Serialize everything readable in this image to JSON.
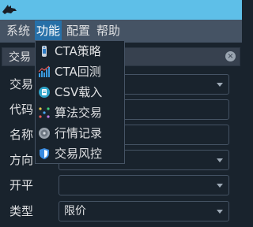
{
  "window": {
    "logo_icon": "wolf-logo-icon"
  },
  "menubar": {
    "items": [
      {
        "label": "系统"
      },
      {
        "label": "功能"
      },
      {
        "label": "配置"
      },
      {
        "label": "帮助"
      }
    ],
    "active_index": 1
  },
  "dock": {
    "title": "交易",
    "close_icon": "close-icon"
  },
  "form": {
    "exchange_label": "交易",
    "symbol_label": "代码",
    "name_label": "名称",
    "direction_label": "方向",
    "offset_label": "开平",
    "order_type_label": "类型",
    "order_type_value": "限价"
  },
  "function_menu": {
    "items": [
      {
        "label": "CTA策略",
        "icon": "cta-strategy-icon"
      },
      {
        "label": "CTA回测",
        "icon": "backtest-chart-icon"
      },
      {
        "label": "CSV载入",
        "icon": "csv-load-icon"
      },
      {
        "label": "算法交易",
        "icon": "algo-trading-icon"
      },
      {
        "label": "行情记录",
        "icon": "data-recorder-icon"
      },
      {
        "label": "交易风控",
        "icon": "risk-shield-icon"
      }
    ]
  },
  "colors": {
    "background": "#19232d",
    "titlebar": "#5ebfe8",
    "menubar": "#455364",
    "menu_active": "#2770a8",
    "text": "#e0e1e3"
  }
}
